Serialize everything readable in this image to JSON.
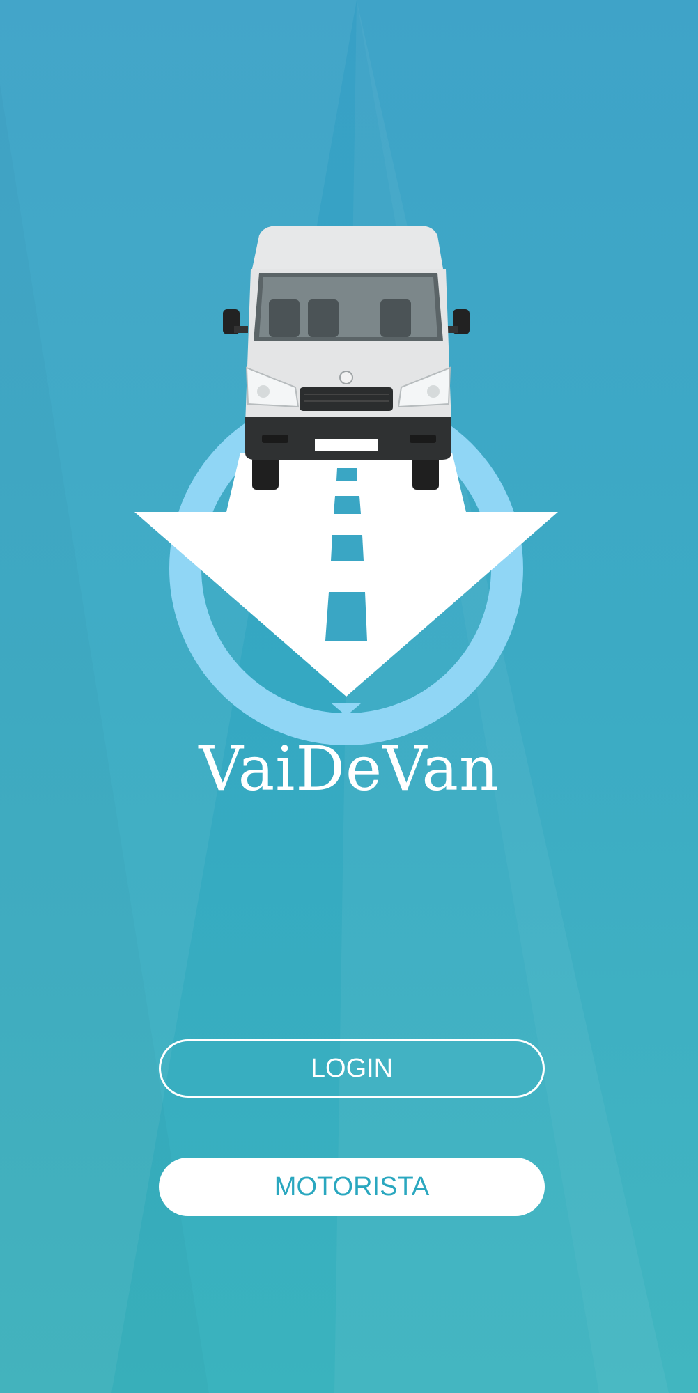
{
  "app": {
    "brand_name": "VaiDeVan"
  },
  "buttons": {
    "login_label": "LOGIN",
    "motorista_label": "MOTORISTA"
  },
  "colors": {
    "background_top": "#38a0c6",
    "background_bottom": "#3ab3be",
    "ring": "#90d6f5",
    "arrow": "#ffffff",
    "road_dash": "#3aa6c4",
    "button_text_motorista": "#2aa7bf"
  },
  "icons": {
    "logo": "van-road-arrow-logo"
  }
}
